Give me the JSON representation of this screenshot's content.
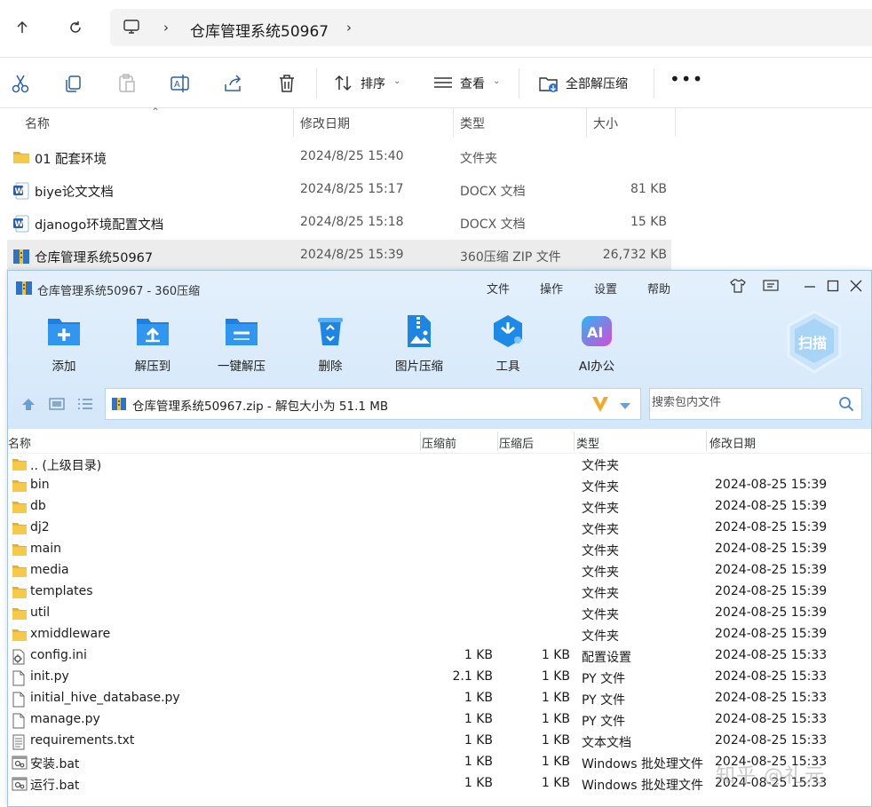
{
  "explorer": {
    "breadcrumb": "仓库管理系统50967",
    "sort_label": "排序",
    "view_label": "查看",
    "extract_all_label": "全部解压缩",
    "columns": {
      "name": "名称",
      "modified": "修改日期",
      "type": "类型",
      "size": "大小"
    },
    "files": [
      {
        "name": "01 配套环境",
        "date": "2024/8/25 15:40",
        "type": "文件夹",
        "size": "",
        "icon": "folder-icon"
      },
      {
        "name": "biye论文文档",
        "date": "2024/8/25 15:17",
        "type": "DOCX 文档",
        "size": "81 KB",
        "icon": "word-doc-icon"
      },
      {
        "name": "djanogo环境配置文档",
        "date": "2024/8/25 15:18",
        "type": "DOCX 文档",
        "size": "15 KB",
        "icon": "word-doc-icon"
      },
      {
        "name": "仓库管理系统50967",
        "date": "2024/8/25 15:39",
        "type": "360压缩 ZIP 文件",
        "size": "26,732 KB",
        "icon": "zip-archive-icon"
      }
    ]
  },
  "zipwindow": {
    "title": "仓库管理系统50967 - 360压缩",
    "menu": [
      "文件",
      "操作",
      "设置",
      "帮助"
    ],
    "tools": [
      "添加",
      "解压到",
      "一键解压",
      "删除",
      "图片压缩",
      "工具",
      "AI办公"
    ],
    "scan_label": "扫描",
    "path_text": "仓库管理系统50967.zip - 解包大小为 51.1 MB",
    "search_placeholder": "搜索包内文件",
    "columns": {
      "name": "名称",
      "orig": "压缩前",
      "comp": "压缩后",
      "type": "类型",
      "date": "修改日期"
    },
    "entries": [
      {
        "name": ".. (上级目录)",
        "orig": "",
        "comp": "",
        "type": "文件夹",
        "date": "",
        "kind": "folder"
      },
      {
        "name": "bin",
        "orig": "",
        "comp": "",
        "type": "文件夹",
        "date": "2024-08-25 15:39",
        "kind": "folder"
      },
      {
        "name": "db",
        "orig": "",
        "comp": "",
        "type": "文件夹",
        "date": "2024-08-25 15:39",
        "kind": "folder"
      },
      {
        "name": "dj2",
        "orig": "",
        "comp": "",
        "type": "文件夹",
        "date": "2024-08-25 15:39",
        "kind": "folder"
      },
      {
        "name": "main",
        "orig": "",
        "comp": "",
        "type": "文件夹",
        "date": "2024-08-25 15:39",
        "kind": "folder"
      },
      {
        "name": "media",
        "orig": "",
        "comp": "",
        "type": "文件夹",
        "date": "2024-08-25 15:39",
        "kind": "folder"
      },
      {
        "name": "templates",
        "orig": "",
        "comp": "",
        "type": "文件夹",
        "date": "2024-08-25 15:39",
        "kind": "folder"
      },
      {
        "name": "util",
        "orig": "",
        "comp": "",
        "type": "文件夹",
        "date": "2024-08-25 15:39",
        "kind": "folder"
      },
      {
        "name": "xmiddleware",
        "orig": "",
        "comp": "",
        "type": "文件夹",
        "date": "2024-08-25 15:39",
        "kind": "folder"
      },
      {
        "name": "config.ini",
        "orig": "1 KB",
        "comp": "1 KB",
        "type": "配置设置",
        "date": "2024-08-25 15:33",
        "kind": "config"
      },
      {
        "name": "init.py",
        "orig": "2.1 KB",
        "comp": "1 KB",
        "type": "PY 文件",
        "date": "2024-08-25 15:33",
        "kind": "file"
      },
      {
        "name": "initial_hive_database.py",
        "orig": "1 KB",
        "comp": "1 KB",
        "type": "PY 文件",
        "date": "2024-08-25 15:33",
        "kind": "file"
      },
      {
        "name": "manage.py",
        "orig": "1 KB",
        "comp": "1 KB",
        "type": "PY 文件",
        "date": "2024-08-25 15:33",
        "kind": "file"
      },
      {
        "name": "requirements.txt",
        "orig": "1 KB",
        "comp": "1 KB",
        "type": "文本文档",
        "date": "2024-08-25 15:33",
        "kind": "text"
      },
      {
        "name": "安装.bat",
        "orig": "1 KB",
        "comp": "1 KB",
        "type": "Windows 批处理文件",
        "date": "2024-08-25 15:33",
        "kind": "bat"
      },
      {
        "name": "运行.bat",
        "orig": "1 KB",
        "comp": "1 KB",
        "type": "Windows 批处理文件",
        "date": "2024-08-25 15:33",
        "kind": "bat"
      }
    ]
  },
  "watermark": "知乎 @礼元",
  "colors": {
    "accent": "#1e88e5",
    "folder": "#f5c342",
    "selected_row": "#ececec",
    "zip_header": "#d8e9fb"
  }
}
